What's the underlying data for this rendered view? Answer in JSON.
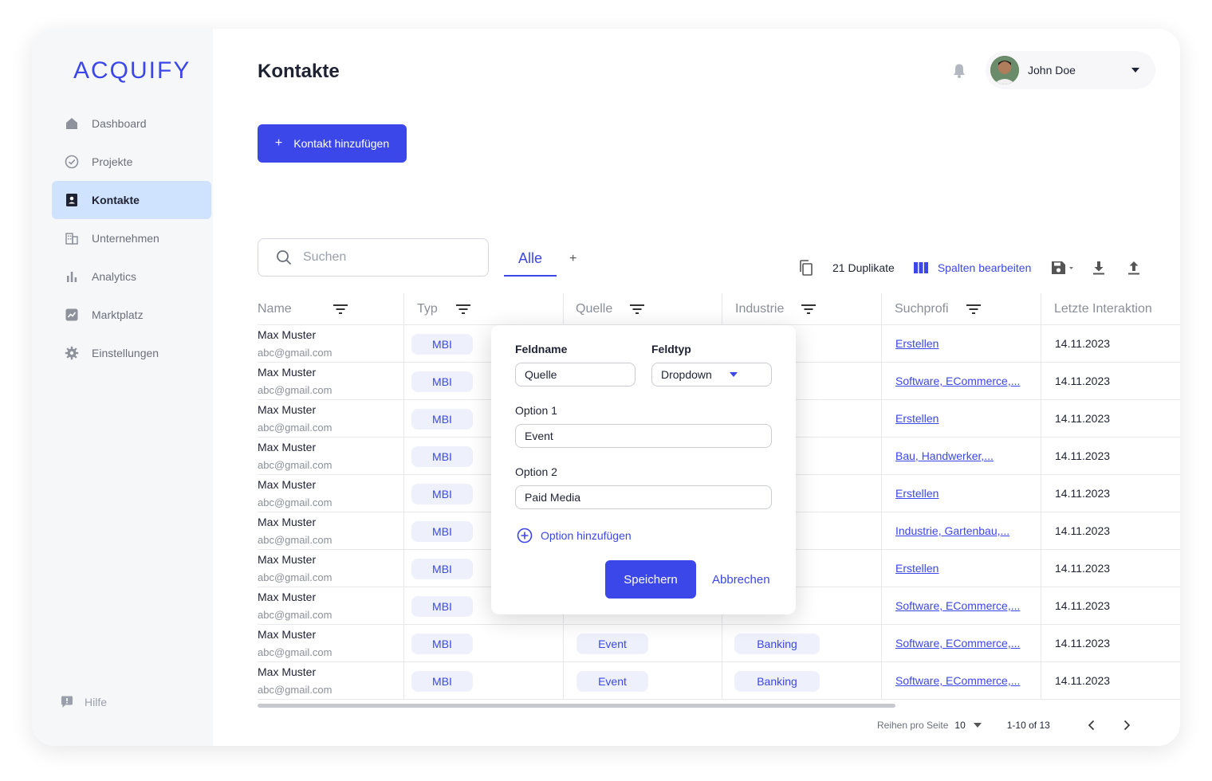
{
  "brand": {
    "logo": "ACQUIFY",
    "accent": "#3b47e8"
  },
  "sidebar": {
    "items": [
      {
        "label": "Dashboard",
        "icon": "home-icon"
      },
      {
        "label": "Projekte",
        "icon": "check-circle-icon"
      },
      {
        "label": "Kontakte",
        "icon": "contact-card-icon",
        "active": true
      },
      {
        "label": "Unternehmen",
        "icon": "building-icon"
      },
      {
        "label": "Analytics",
        "icon": "bar-chart-icon"
      },
      {
        "label": "Marktplatz",
        "icon": "trend-chart-icon"
      },
      {
        "label": "Einstellungen",
        "icon": "gear-icon"
      }
    ],
    "help": "Hilfe"
  },
  "header": {
    "title": "Kontakte",
    "user_name": "John Doe"
  },
  "actions": {
    "add_contact": "Kontakt hinzufügen"
  },
  "search": {
    "placeholder": "Suchen",
    "value": ""
  },
  "tabs": {
    "active": "Alle",
    "add": "+"
  },
  "toolbar": {
    "duplicates": "21 Duplikate",
    "edit_columns": "Spalten bearbeiten"
  },
  "table": {
    "columns": [
      "Name",
      "Typ",
      "Quelle",
      "Industrie",
      "Suchprofi",
      "Letzte Interaktion"
    ],
    "rows": [
      {
        "name": "Max Muster",
        "email": "abc@gmail.com",
        "typ": "MBI",
        "quelle": "",
        "industrie": "",
        "profil": "Erstellen",
        "date": "14.11.2023"
      },
      {
        "name": "Max Muster",
        "email": "abc@gmail.com",
        "typ": "MBI",
        "quelle": "",
        "industrie": "",
        "profil": "Software, ECommerce,...",
        "date": "14.11.2023"
      },
      {
        "name": "Max Muster",
        "email": "abc@gmail.com",
        "typ": "MBI",
        "quelle": "",
        "industrie": "",
        "profil": "Erstellen",
        "date": "14.11.2023"
      },
      {
        "name": "Max Muster",
        "email": "abc@gmail.com",
        "typ": "MBI",
        "quelle": "",
        "industrie": "",
        "profil": "Bau, Handwerker,...",
        "date": "14.11.2023"
      },
      {
        "name": "Max Muster",
        "email": "abc@gmail.com",
        "typ": "MBI",
        "quelle": "",
        "industrie": "",
        "profil": "Erstellen",
        "date": "14.11.2023"
      },
      {
        "name": "Max Muster",
        "email": "abc@gmail.com",
        "typ": "MBI",
        "quelle": "",
        "industrie": "",
        "profil": "Industrie, Gartenbau,...",
        "date": "14.11.2023"
      },
      {
        "name": "Max Muster",
        "email": "abc@gmail.com",
        "typ": "MBI",
        "quelle": "",
        "industrie": "",
        "profil": "Erstellen",
        "date": "14.11.2023"
      },
      {
        "name": "Max Muster",
        "email": "abc@gmail.com",
        "typ": "MBI",
        "quelle": "",
        "industrie": "",
        "profil": "Software, ECommerce,...",
        "date": "14.11.2023"
      },
      {
        "name": "Max Muster",
        "email": "abc@gmail.com",
        "typ": "MBI",
        "quelle": "Event",
        "industrie": "Banking",
        "profil": "Software, ECommerce,...",
        "date": "14.11.2023"
      },
      {
        "name": "Max Muster",
        "email": "abc@gmail.com",
        "typ": "MBI",
        "quelle": "Event",
        "industrie": "Banking",
        "profil": "Software, ECommerce,...",
        "date": "14.11.2023"
      }
    ]
  },
  "pagination": {
    "rows_label": "Reihen pro Seite",
    "rows_value": "10",
    "range": "1-10 of 13"
  },
  "modal": {
    "fieldname_label": "Feldname",
    "fieldname_value": "Quelle",
    "fieldtype_label": "Feldtyp",
    "fieldtype_value": "Dropdown",
    "option1_label": "Option 1",
    "option1_value": "Event",
    "option2_label": "Option 2",
    "option2_value": "Paid Media",
    "add_option": "Option hinzufügen",
    "save": "Speichern",
    "cancel": "Abbrechen"
  }
}
